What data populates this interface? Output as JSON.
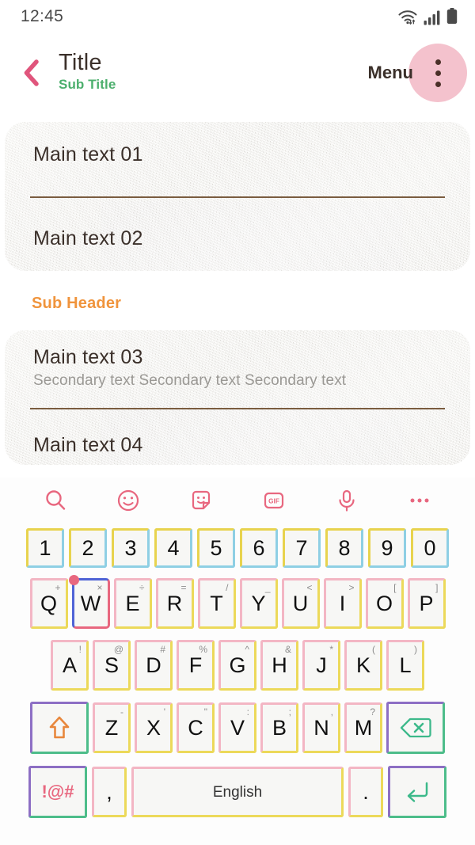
{
  "status_bar": {
    "clock": "12:45",
    "icons": [
      "wifi-icon",
      "signal-icon",
      "battery-icon"
    ]
  },
  "app_bar": {
    "back_icon": "chevron-left-icon",
    "title": "Title",
    "subtitle": "Sub Title",
    "menu_label": "Menu",
    "overflow_icon": "more-vertical-icon",
    "colors": {
      "back_arrow": "#e0557c",
      "title": "#3b302a",
      "subtitle": "#4caf6d",
      "overflow_bg": "#f4c2cd"
    }
  },
  "content": {
    "card_one": {
      "rows": [
        {
          "main": "Main text 01"
        },
        {
          "main": "Main text 02"
        }
      ]
    },
    "sub_header": "Sub Header",
    "card_two": {
      "rows": [
        {
          "main": "Main text 03",
          "secondary": "Secondary text Secondary text Secondary text"
        },
        {
          "main": "Main text 04"
        }
      ]
    },
    "colors": {
      "card_bg": "#efeeec",
      "divider": "#7a5c3f",
      "sub_header": "#f0943c",
      "main_text": "#3b302a",
      "secondary_text": "#9a9894"
    }
  },
  "keyboard": {
    "toolbar": [
      {
        "name": "search-icon",
        "label": ""
      },
      {
        "name": "emoji-icon",
        "label": ""
      },
      {
        "name": "sticker-icon",
        "label": ""
      },
      {
        "name": "gif-icon",
        "label": "GIF"
      },
      {
        "name": "microphone-icon",
        "label": ""
      },
      {
        "name": "more-horizontal-icon",
        "label": ""
      }
    ],
    "toolbar_color": "#e8677f",
    "rows": {
      "numbers": [
        {
          "glyph": "1"
        },
        {
          "glyph": "2"
        },
        {
          "glyph": "3"
        },
        {
          "glyph": "4"
        },
        {
          "glyph": "5"
        },
        {
          "glyph": "6"
        },
        {
          "glyph": "7"
        },
        {
          "glyph": "8"
        },
        {
          "glyph": "9"
        },
        {
          "glyph": "0"
        }
      ],
      "top": [
        {
          "glyph": "Q",
          "sub": "+"
        },
        {
          "glyph": "W",
          "sub": "×",
          "active": true
        },
        {
          "glyph": "E",
          "sub": "÷"
        },
        {
          "glyph": "R",
          "sub": "="
        },
        {
          "glyph": "T",
          "sub": "/"
        },
        {
          "glyph": "Y",
          "sub": "_"
        },
        {
          "glyph": "U",
          "sub": "<"
        },
        {
          "glyph": "I",
          "sub": ">"
        },
        {
          "glyph": "O",
          "sub": "["
        },
        {
          "glyph": "P",
          "sub": "]"
        }
      ],
      "home": [
        {
          "glyph": "A",
          "sub": "!"
        },
        {
          "glyph": "S",
          "sub": "@"
        },
        {
          "glyph": "D",
          "sub": "#"
        },
        {
          "glyph": "F",
          "sub": "%"
        },
        {
          "glyph": "G",
          "sub": "^"
        },
        {
          "glyph": "H",
          "sub": "&"
        },
        {
          "glyph": "J",
          "sub": "*"
        },
        {
          "glyph": "K",
          "sub": "("
        },
        {
          "glyph": "L",
          "sub": ")"
        }
      ],
      "bottom_letters": [
        {
          "glyph": "Z",
          "sub": "-"
        },
        {
          "glyph": "X",
          "sub": "'"
        },
        {
          "glyph": "C",
          "sub": "\""
        },
        {
          "glyph": "V",
          "sub": ":"
        },
        {
          "glyph": "B",
          "sub": ";"
        },
        {
          "glyph": "N",
          "sub": ","
        },
        {
          "glyph": "M",
          "sub": "?"
        }
      ],
      "shift_icon": "shift-arrow-icon",
      "backspace_icon": "backspace-icon",
      "symbols_label": "!@#",
      "comma_label": ",",
      "space_label": "English",
      "period_label": ".",
      "enter_icon": "enter-return-icon"
    },
    "colors": {
      "key_bg": "#f7f7f5",
      "num_border_a": "#e8d34e",
      "num_border_b": "#8ecfe4",
      "letter_border_a": "#f3b6c4",
      "letter_border_b": "#ecd95a",
      "mod_border_a": "#8d6fc4",
      "mod_border_b": "#4dbd8a",
      "active_border_a": "#4f63d6",
      "active_border_b": "#e8677f",
      "shift_glyph": "#e8873c",
      "mod_glyph": "#3cb98a"
    }
  }
}
